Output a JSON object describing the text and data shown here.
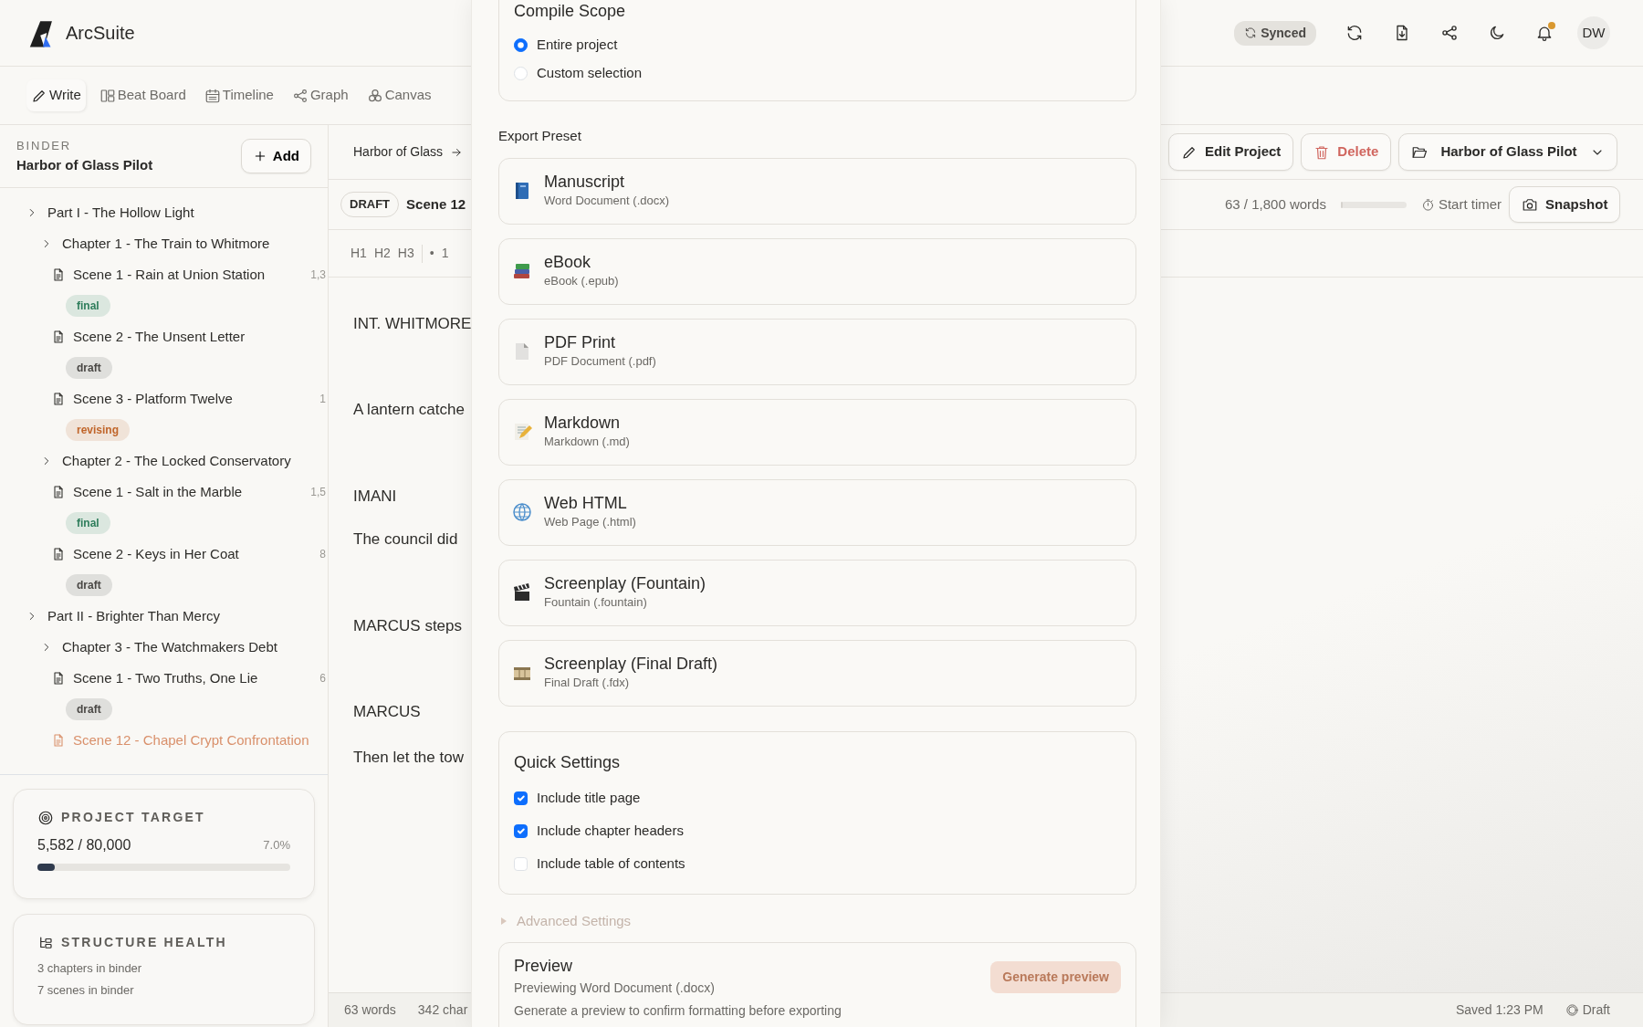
{
  "app": {
    "name": "ArcSuite"
  },
  "header": {
    "sync_status": "Synced",
    "avatar": "DW",
    "notification_unread": true
  },
  "tabs": [
    {
      "label": "Write",
      "selected": true
    },
    {
      "label": "Beat Board",
      "selected": false
    },
    {
      "label": "Timeline",
      "selected": false
    },
    {
      "label": "Graph",
      "selected": false
    },
    {
      "label": "Canvas",
      "selected": false
    }
  ],
  "binder": {
    "heading": "BINDER",
    "project": "Harbor of Glass Pilot",
    "add_button": "Add",
    "tree": [
      {
        "kind": "part",
        "title": "Part I - The Hollow Light",
        "selected": false,
        "children": [
          {
            "kind": "chapter",
            "title": "Chapter 1 - The Train to Whitmore",
            "selected": false,
            "children": [
              {
                "kind": "scene",
                "title": "Scene 1 - Rain at Union Station",
                "count": "1,3",
                "selected": false,
                "tag": {
                  "label": "final",
                  "color": "#2e7d5b"
                }
              },
              {
                "kind": "scene",
                "title": "Scene 2 - The Unsent Letter",
                "selected": false,
                "tag": {
                  "label": "draft",
                  "color": "#4a4845"
                }
              },
              {
                "kind": "scene",
                "title": "Scene 3 - Platform Twelve",
                "count": "1",
                "selected": false,
                "tag": {
                  "label": "revising",
                  "color": "#c0652a"
                }
              }
            ]
          },
          {
            "kind": "chapter",
            "title": "Chapter 2 - The Locked Conservatory",
            "selected": false,
            "children": [
              {
                "kind": "scene",
                "title": "Scene 1 - Salt in the Marble",
                "count": "1,5",
                "selected": false,
                "tag": {
                  "label": "final",
                  "color": "#2e7d5b"
                }
              },
              {
                "kind": "scene",
                "title": "Scene 2 - Keys in Her Coat",
                "count": "8",
                "selected": false,
                "tag": {
                  "label": "draft",
                  "color": "#4a4845"
                }
              }
            ]
          }
        ]
      },
      {
        "kind": "part",
        "title": "Part II - Brighter Than Mercy",
        "selected": false,
        "children": [
          {
            "kind": "chapter",
            "title": "Chapter 3 - The Watchmakers Debt",
            "selected": false,
            "children": [
              {
                "kind": "scene",
                "title": "Scene 1 - Two Truths, One Lie",
                "count": "6",
                "selected": false,
                "tag": {
                  "label": "draft",
                  "color": "#4a4845"
                }
              },
              {
                "kind": "scene",
                "title": "Scene 12 - Chapel Crypt Confrontation",
                "selected": true
              }
            ]
          }
        ]
      }
    ]
  },
  "project_target": {
    "title": "PROJECT TARGET",
    "progress": "5,582 / 80,000",
    "percent": "7.0%",
    "level": 0.07
  },
  "structure_health": {
    "title": "STRUCTURE HEALTH",
    "lines": [
      "3 chapters in binder",
      "7 scenes in binder"
    ]
  },
  "editor": {
    "breadcrumb": "Harbor of Glass",
    "status_badge": "DRAFT",
    "scene_title": "Scene 12",
    "format_buttons": [
      "H1",
      "H2",
      "H3",
      "•",
      "1"
    ],
    "lines": [
      "INT. WHITMORE",
      "A lantern catche",
      "IMANI",
      "The council did",
      "MARCUS steps",
      "MARCUS",
      "Then let the tow"
    ],
    "actions": {
      "edit": "Edit Project",
      "delete": "Delete",
      "project_select": "Harbor of Glass Pilot"
    },
    "word_goal": {
      "text": "63 / 1,800 words",
      "level": 0.035
    },
    "timer": "Start timer",
    "snapshot": "Snapshot",
    "status_bar": {
      "words": "63 words",
      "chars": "342 char",
      "saved": "Saved 1:23 PM",
      "state": "Draft"
    }
  },
  "compile_panel": {
    "scope": {
      "title": "Compile Scope",
      "options": [
        {
          "label": "Entire project",
          "selected": true
        },
        {
          "label": "Custom selection",
          "selected": false
        }
      ]
    },
    "preset_heading": "Export Preset",
    "presets": [
      {
        "kind": "book",
        "name": "Manuscript",
        "format": "Word Document (.docx)"
      },
      {
        "kind": "books",
        "name": "eBook",
        "format": "eBook (.epub)"
      },
      {
        "kind": "page",
        "name": "PDF Print",
        "format": "PDF Document (.pdf)"
      },
      {
        "kind": "memo",
        "name": "Markdown",
        "format": "Markdown (.md)"
      },
      {
        "kind": "globe",
        "name": "Web HTML",
        "format": "Web Page (.html)"
      },
      {
        "kind": "clapper",
        "name": "Screenplay (Fountain)",
        "format": "Fountain (.fountain)"
      },
      {
        "kind": "film",
        "name": "Screenplay (Final Draft)",
        "format": "Final Draft (.fdx)"
      }
    ],
    "quick_settings": {
      "title": "Quick Settings",
      "options": [
        {
          "label": "Include title page",
          "checked": true
        },
        {
          "label": "Include chapter headers",
          "checked": true
        },
        {
          "label": "Include table of contents",
          "checked": false
        }
      ]
    },
    "advanced": "Advanced Settings",
    "preview": {
      "title": "Preview",
      "subtitle": "Previewing Word Document (.docx)",
      "button": "Generate preview",
      "hint": "Generate a preview to confirm formatting before exporting"
    }
  }
}
